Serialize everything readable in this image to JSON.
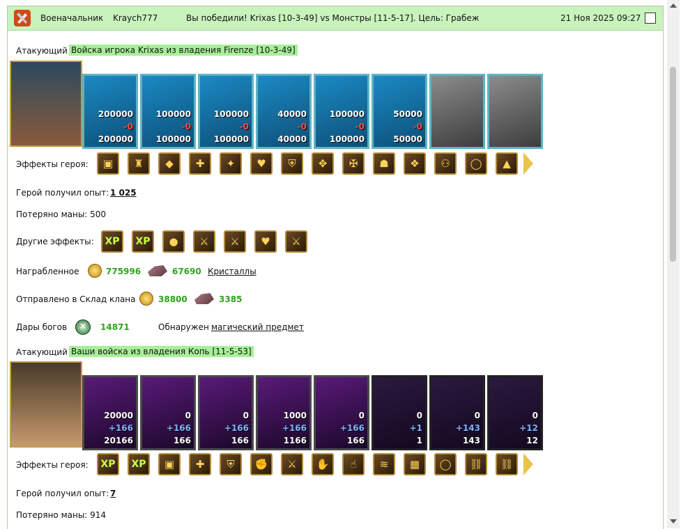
{
  "header": {
    "role": "Военачальник",
    "username": "Kraych777",
    "message": "Вы победили! Krixas [10-3-49] vs Монстры [11-5-17]. Цель: Грабеж",
    "datetime": "21 Ноя 2025 09:27"
  },
  "colors": {
    "header_bg": "#c9f3bd",
    "highlight": "#a8ef99",
    "value_green": "#2ea31d"
  },
  "battle1": {
    "attacker_label": "Атакующий",
    "attacker_title": "Войска игрока Krixas из владения Firenze [10-3-49]",
    "units": [
      {
        "top": "200000",
        "mid": "-0",
        "bottom": "200000",
        "style": "blue"
      },
      {
        "top": "100000",
        "mid": "-0",
        "bottom": "100000",
        "style": "blue"
      },
      {
        "top": "100000",
        "mid": "-0",
        "bottom": "100000",
        "style": "blue"
      },
      {
        "top": "40000",
        "mid": "-0",
        "bottom": "40000",
        "style": "blue"
      },
      {
        "top": "100000",
        "mid": "-0",
        "bottom": "100000",
        "style": "blue"
      },
      {
        "top": "50000",
        "mid": "-0",
        "bottom": "50000",
        "style": "blue"
      },
      {
        "top": "",
        "mid": "",
        "bottom": "",
        "style": "gray"
      },
      {
        "top": "",
        "mid": "",
        "bottom": "",
        "style": "gray"
      }
    ],
    "hero_effects_label": "Эффекты героя:",
    "hero_effects": [
      "chest-icon",
      "armor-icon",
      "gems-icon",
      "gift-icon",
      "treasure-icon",
      "heart-icon",
      "shield-icon",
      "armor-red-icon",
      "cross-icon",
      "helmet-icon",
      "mask-icon",
      "boots-icon",
      "ring-icon",
      "tent-icon"
    ],
    "exp_label": "Герой получил опыт:",
    "exp_value": "1 025",
    "mana_label": "Потеряно маны: 500",
    "other_effects_label": "Другие эффекты:",
    "other_effects": [
      "XP",
      "XP",
      "gold",
      "sword",
      "sword",
      "heart",
      "sword"
    ],
    "loot_label": "Награбленное",
    "loot_gold": "775996",
    "loot_crystals": "67690",
    "loot_crystals_link": "Кристаллы",
    "clan_label": "Отправлено в Склад клана",
    "clan_gold": "38800",
    "clan_crystals": "3385",
    "gods_label": "Дары богов",
    "gods_value": "14871",
    "found_label": "Обнаружен",
    "found_link": "магический предмет"
  },
  "battle2": {
    "attacker_label": "Атакующий",
    "attacker_title": "Ваши войска из владения Копь [11-5-53]",
    "units": [
      {
        "top": "20000",
        "mid": "+166",
        "bottom": "20166",
        "style": "purple"
      },
      {
        "top": "0",
        "mid": "+166",
        "bottom": "166",
        "style": "purple"
      },
      {
        "top": "0",
        "mid": "+166",
        "bottom": "166",
        "style": "purple"
      },
      {
        "top": "1000",
        "mid": "+166",
        "bottom": "1166",
        "style": "purple"
      },
      {
        "top": "0",
        "mid": "+166",
        "bottom": "166",
        "style": "purple"
      },
      {
        "top": "0",
        "mid": "+1",
        "bottom": "1",
        "style": "dark"
      },
      {
        "top": "0",
        "mid": "+143",
        "bottom": "143",
        "style": "dark"
      },
      {
        "top": "0",
        "mid": "+12",
        "bottom": "12",
        "style": "dark"
      }
    ],
    "hero_effects_label": "Эффекты героя:",
    "hero_effects": [
      "XP",
      "XP",
      "chest",
      "gift",
      "shield",
      "fist",
      "sword",
      "handshake",
      "hand",
      "claws",
      "cage",
      "ring",
      "chain",
      "chain"
    ],
    "exp_label": "Герой получил опыт:",
    "exp_value": "7",
    "mana_label": "Потеряно маны: 914"
  }
}
